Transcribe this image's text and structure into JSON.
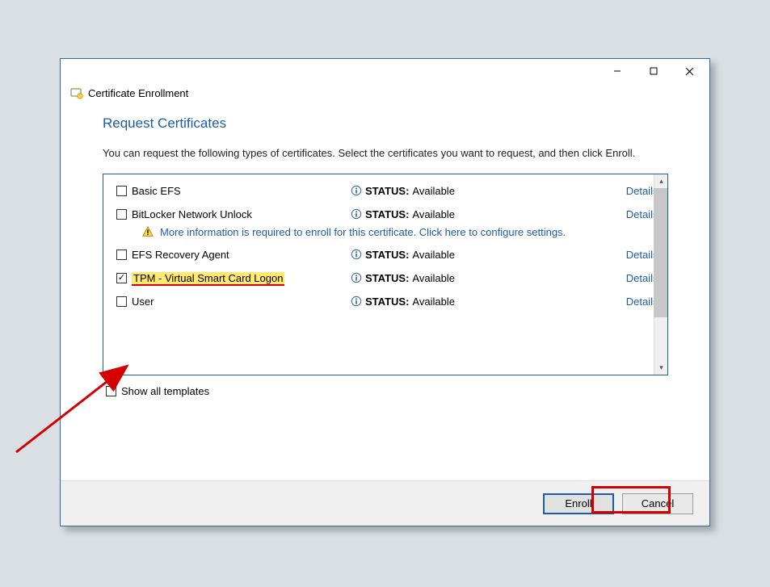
{
  "window": {
    "title": "Certificate Enrollment"
  },
  "page": {
    "heading": "Request Certificates",
    "instructions": "You can request the following types of certificates. Select the certificates you want to request, and then click Enroll."
  },
  "templates": [
    {
      "name": "Basic EFS",
      "checked": false,
      "status_label": "STATUS:",
      "status_value": "Available",
      "details": "Details",
      "warning": null,
      "highlight": false
    },
    {
      "name": "BitLocker Network Unlock",
      "checked": false,
      "status_label": "STATUS:",
      "status_value": "Available",
      "details": "Details",
      "warning": "More information is required to enroll for this certificate. Click here to configure settings.",
      "highlight": false
    },
    {
      "name": "EFS Recovery Agent",
      "checked": false,
      "status_label": "STATUS:",
      "status_value": "Available",
      "details": "Details",
      "warning": null,
      "highlight": false
    },
    {
      "name": "TPM - Virtual Smart Card Logon",
      "checked": true,
      "status_label": "STATUS:",
      "status_value": "Available",
      "details": "Details",
      "warning": null,
      "highlight": true
    },
    {
      "name": "User",
      "checked": false,
      "status_label": "STATUS:",
      "status_value": "Available",
      "details": "Details",
      "warning": null,
      "highlight": false
    }
  ],
  "show_all": {
    "label": "Show all templates",
    "checked": false
  },
  "buttons": {
    "enroll": "Enroll",
    "cancel": "Cancel"
  }
}
